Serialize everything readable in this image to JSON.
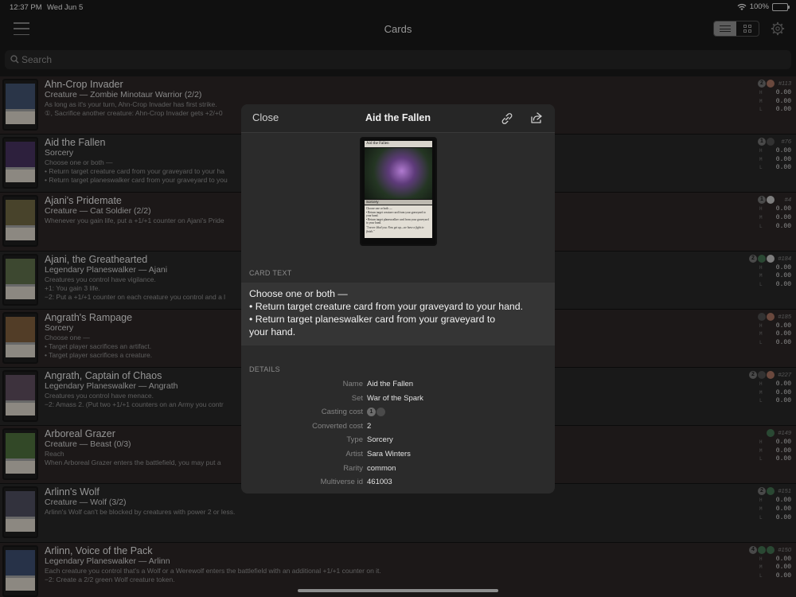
{
  "status": {
    "time": "12:37 PM",
    "date": "Wed Jun 5",
    "battery": "100%"
  },
  "nav": {
    "title": "Cards"
  },
  "search": {
    "placeholder": "Search"
  },
  "cards": [
    {
      "name": "Ahn-Crop Invader",
      "type": "Creature — Zombie Minotaur Warrior (2/2)",
      "lines": [
        "As long as it's your turn, Ahn-Crop Invader has first strike.",
        "①, Sacrifice another creature: Ahn-Crop Invader gets +2/+0"
      ],
      "mana": [
        {
          "s": "2",
          "c": "gen"
        },
        {
          "s": "",
          "c": "red"
        }
      ],
      "number": "#113",
      "prices": {
        "H": "0.00",
        "M": "0.00",
        "L": "0.00"
      },
      "art": "#3f4f6a"
    },
    {
      "name": "Aid the Fallen",
      "type": "Sorcery",
      "lines": [
        "Choose one or both —",
        "• Return target creature card from your graveyard to your ha",
        "• Return target planeswalker card from your graveyard to you"
      ],
      "mana": [
        {
          "s": "1",
          "c": "gen"
        },
        {
          "s": "",
          "c": "black"
        }
      ],
      "number": "#76",
      "prices": {
        "H": "0.00",
        "M": "0.00",
        "L": "0.00"
      },
      "art": "#43305a"
    },
    {
      "name": "Ajani's Pridemate",
      "type": "Creature — Cat Soldier (2/2)",
      "lines": [
        "Whenever you gain life, put a +1/+1 counter on Ajani's Pride"
      ],
      "mana": [
        {
          "s": "1",
          "c": "gen"
        },
        {
          "s": "",
          "c": "white"
        }
      ],
      "number": "#4",
      "prices": {
        "H": "0.00",
        "M": "0.00",
        "L": "0.00"
      },
      "art": "#6a6440"
    },
    {
      "name": "Ajani, the Greathearted",
      "type": "Legendary Planeswalker — Ajani",
      "lines": [
        "Creatures you control have vigilance.",
        "+1: You gain 3 life.",
        "−2: Put a +1/+1 counter on each creature you control and a l"
      ],
      "mana": [
        {
          "s": "2",
          "c": "gen"
        },
        {
          "s": "",
          "c": "green"
        },
        {
          "s": "",
          "c": "white"
        }
      ],
      "number": "#184",
      "prices": {
        "H": "0.00",
        "M": "0.00",
        "L": "0.00"
      },
      "art": "#5a6a48"
    },
    {
      "name": "Angrath's Rampage",
      "type": "Sorcery",
      "lines": [
        "Choose one —",
        "• Target player sacrifices an artifact.",
        "• Target player sacrifices a creature."
      ],
      "mana": [
        {
          "s": "",
          "c": "black"
        },
        {
          "s": "",
          "c": "red"
        }
      ],
      "number": "#185",
      "prices": {
        "H": "0.00",
        "M": "0.00",
        "L": "0.00"
      },
      "art": "#7a5a3a"
    },
    {
      "name": "Angrath, Captain of Chaos",
      "type": "Legendary Planeswalker — Angrath",
      "lines": [
        "Creatures you control have menace.",
        "−2: Amass 2. (Put two +1/+1 counters on an Army you contr"
      ],
      "mana": [
        {
          "s": "2",
          "c": "gen"
        },
        {
          "s": "",
          "c": "black"
        },
        {
          "s": "",
          "c": "red"
        }
      ],
      "number": "#227",
      "prices": {
        "H": "0.00",
        "M": "0.00",
        "L": "0.00"
      },
      "art": "#5a4a5a"
    },
    {
      "name": "Arboreal Grazer",
      "type": "Creature — Beast (0/3)",
      "lines": [
        "Reach",
        "When Arboreal Grazer enters the battlefield, you may put a"
      ],
      "mana": [
        {
          "s": "",
          "c": "green"
        }
      ],
      "number": "#149",
      "prices": {
        "H": "0.00",
        "M": "0.00",
        "L": "0.00"
      },
      "art": "#4a6a3a"
    },
    {
      "name": "Arlinn's Wolf",
      "type": "Creature — Wolf (3/2)",
      "lines": [
        "Arlinn's Wolf can't be blocked by creatures with power 2 or less."
      ],
      "mana": [
        {
          "s": "2",
          "c": "gen"
        },
        {
          "s": "",
          "c": "green"
        }
      ],
      "number": "#151",
      "prices": {
        "H": "0.00",
        "M": "0.00",
        "L": "0.00"
      },
      "art": "#4a4a5a"
    },
    {
      "name": "Arlinn, Voice of the Pack",
      "type": "Legendary Planeswalker — Arlinn",
      "lines": [
        "Each creature you control that's a Wolf or a Werewolf enters the battlefield with an additional +1/+1 counter on it.",
        "−2: Create a 2/2 green Wolf creature token."
      ],
      "mana": [
        {
          "s": "4",
          "c": "gen"
        },
        {
          "s": "",
          "c": "green"
        },
        {
          "s": "",
          "c": "green"
        }
      ],
      "number": "#150",
      "prices": {
        "H": "0.00",
        "M": "0.00",
        "L": "0.00"
      },
      "art": "#3a4a6a"
    }
  ],
  "modal": {
    "close_label": "Close",
    "title": "Aid the Fallen",
    "image": {
      "title": "Aid the Fallen",
      "type": "Sorcery",
      "text": [
        "Choose one or both —",
        "• Return target creature card from your graveyard to your hand.",
        "• Return target planeswalker card from your graveyard to your hand."
      ],
      "flavor": "\"I never liked you. Now get up—we have a fight to finish.\""
    },
    "card_text_label": "CARD TEXT",
    "card_text": [
      "Choose one or both —",
      "• Return target creature card from your graveyard to your hand.",
      "• Return target planeswalker card from your graveyard to",
      "your hand."
    ],
    "details_label": "DETAILS",
    "details": [
      {
        "key": "Name",
        "value": "Aid the Fallen"
      },
      {
        "key": "Set",
        "value": "War of the Spark"
      },
      {
        "key": "Casting cost",
        "value": "",
        "mana": [
          {
            "s": "1",
            "c": "gen"
          },
          {
            "s": "",
            "c": "black"
          }
        ]
      },
      {
        "key": "Converted cost",
        "value": "2"
      },
      {
        "key": "Type",
        "value": "Sorcery"
      },
      {
        "key": "Artist",
        "value": "Sara Winters"
      },
      {
        "key": "Rarity",
        "value": "common"
      },
      {
        "key": "Multiverse id",
        "value": "461003"
      }
    ]
  },
  "icons": {
    "menu": "hamburger-icon",
    "list": "list-view-icon",
    "grid": "grid-view-icon",
    "settings": "gear-icon",
    "search": "search-icon",
    "link": "link-icon",
    "share": "share-icon",
    "wifi": "wifi-icon"
  }
}
